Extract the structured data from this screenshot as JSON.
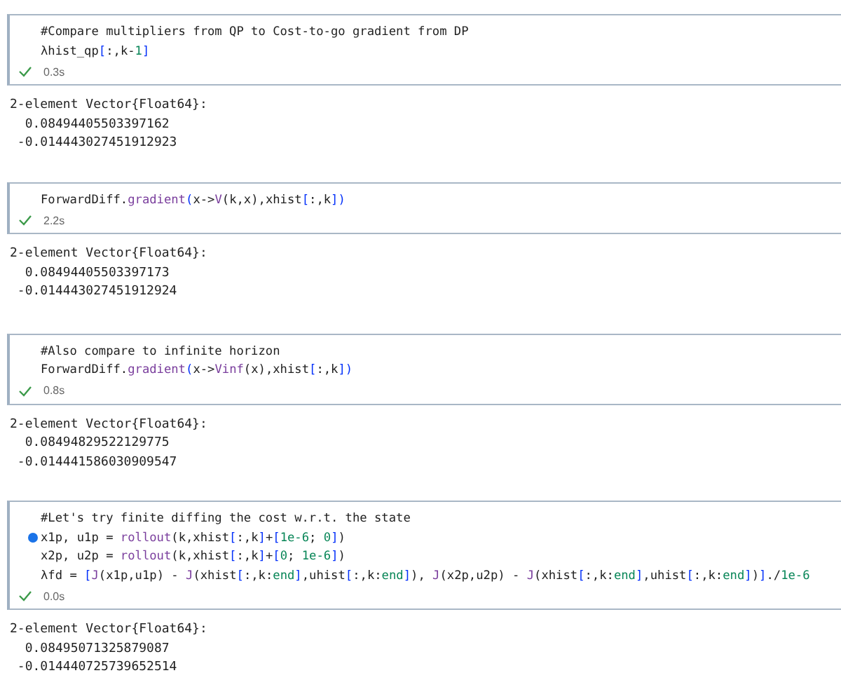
{
  "cells": [
    {
      "code_lines": [
        [
          {
            "t": "#Compare multipliers from QP to Cost-to-go gradient from DP",
            "kind": "text"
          }
        ],
        [
          {
            "t": "λhist_qp",
            "kind": "text"
          },
          {
            "t": "[",
            "kind": "bracket"
          },
          {
            "t": ":,k-",
            "kind": "text"
          },
          {
            "t": "1",
            "kind": "num"
          },
          {
            "t": "]",
            "kind": "bracket"
          }
        ]
      ],
      "time": "0.3s",
      "cursor": false,
      "output": [
        "2-element Vector{Float64}:",
        "  0.08494405503397162",
        " -0.014443027451912923"
      ]
    },
    {
      "code_lines": [
        [
          {
            "t": "ForwardDiff.",
            "kind": "text"
          },
          {
            "t": "gradient",
            "kind": "fn"
          },
          {
            "t": "(",
            "kind": "bracket"
          },
          {
            "t": "x->",
            "kind": "text"
          },
          {
            "t": "V",
            "kind": "fn"
          },
          {
            "t": "(k,x),xhist",
            "kind": "text"
          },
          {
            "t": "[",
            "kind": "bracket"
          },
          {
            "t": ":,k",
            "kind": "text"
          },
          {
            "t": "]",
            "kind": "bracket"
          },
          {
            "t": ")",
            "kind": "bracket"
          }
        ]
      ],
      "time": "2.2s",
      "cursor": false,
      "output": [
        "2-element Vector{Float64}:",
        "  0.08494405503397173",
        " -0.014443027451912924"
      ]
    },
    {
      "code_lines": [
        [
          {
            "t": "#Also compare to infinite horizon",
            "kind": "text"
          }
        ],
        [
          {
            "t": "ForwardDiff.",
            "kind": "text"
          },
          {
            "t": "gradient",
            "kind": "fn"
          },
          {
            "t": "(",
            "kind": "bracket"
          },
          {
            "t": "x->",
            "kind": "text"
          },
          {
            "t": "Vinf",
            "kind": "fn"
          },
          {
            "t": "(x),xhist",
            "kind": "text"
          },
          {
            "t": "[",
            "kind": "bracket"
          },
          {
            "t": ":,k",
            "kind": "text"
          },
          {
            "t": "]",
            "kind": "bracket"
          },
          {
            "t": ")",
            "kind": "bracket"
          }
        ]
      ],
      "time": "0.8s",
      "cursor": false,
      "output": [
        "2-element Vector{Float64}:",
        "  0.08494829522129775",
        " -0.014441586030909547"
      ]
    },
    {
      "code_lines": [
        [
          {
            "t": "#Let's try finite diffing the cost w.r.t. the state",
            "kind": "text"
          }
        ],
        [
          {
            "t": "x1p, u1p = ",
            "kind": "text"
          },
          {
            "t": "rollout",
            "kind": "fn"
          },
          {
            "t": "(k,xhist",
            "kind": "text"
          },
          {
            "t": "[",
            "kind": "bracket"
          },
          {
            "t": ":,k",
            "kind": "text"
          },
          {
            "t": "]",
            "kind": "bracket"
          },
          {
            "t": "+",
            "kind": "text"
          },
          {
            "t": "[",
            "kind": "bracket"
          },
          {
            "t": "1e-6",
            "kind": "num"
          },
          {
            "t": "; ",
            "kind": "text"
          },
          {
            "t": "0",
            "kind": "num"
          },
          {
            "t": "]",
            "kind": "bracket"
          },
          {
            "t": ")",
            "kind": "text"
          }
        ],
        [
          {
            "t": "x2p, u2p = ",
            "kind": "text"
          },
          {
            "t": "rollout",
            "kind": "fn"
          },
          {
            "t": "(k,xhist",
            "kind": "text"
          },
          {
            "t": "[",
            "kind": "bracket"
          },
          {
            "t": ":,k",
            "kind": "text"
          },
          {
            "t": "]",
            "kind": "bracket"
          },
          {
            "t": "+",
            "kind": "text"
          },
          {
            "t": "[",
            "kind": "bracket"
          },
          {
            "t": "0",
            "kind": "num"
          },
          {
            "t": "; ",
            "kind": "text"
          },
          {
            "t": "1e-6",
            "kind": "num"
          },
          {
            "t": "]",
            "kind": "bracket"
          },
          {
            "t": ")",
            "kind": "text"
          }
        ],
        [
          {
            "t": "λfd = ",
            "kind": "text"
          },
          {
            "t": "[",
            "kind": "bracket"
          },
          {
            "t": "J",
            "kind": "fn"
          },
          {
            "t": "(x1p,u1p) - ",
            "kind": "text"
          },
          {
            "t": "J",
            "kind": "fn"
          },
          {
            "t": "(xhist",
            "kind": "text"
          },
          {
            "t": "[",
            "kind": "bracket"
          },
          {
            "t": ":,k:",
            "kind": "text"
          },
          {
            "t": "end",
            "kind": "num"
          },
          {
            "t": "]",
            "kind": "bracket"
          },
          {
            "t": ",uhist",
            "kind": "text"
          },
          {
            "t": "[",
            "kind": "bracket"
          },
          {
            "t": ":,k:",
            "kind": "text"
          },
          {
            "t": "end",
            "kind": "num"
          },
          {
            "t": "]",
            "kind": "bracket"
          },
          {
            "t": "), ",
            "kind": "text"
          },
          {
            "t": "J",
            "kind": "fn"
          },
          {
            "t": "(x2p,u2p) - ",
            "kind": "text"
          },
          {
            "t": "J",
            "kind": "fn"
          },
          {
            "t": "(xhist",
            "kind": "text"
          },
          {
            "t": "[",
            "kind": "bracket"
          },
          {
            "t": ":,k:",
            "kind": "text"
          },
          {
            "t": "end",
            "kind": "num"
          },
          {
            "t": "]",
            "kind": "bracket"
          },
          {
            "t": ",uhist",
            "kind": "text"
          },
          {
            "t": "[",
            "kind": "bracket"
          },
          {
            "t": ":,k:",
            "kind": "text"
          },
          {
            "t": "end",
            "kind": "num"
          },
          {
            "t": "]",
            "kind": "bracket"
          },
          {
            "t": ")",
            "kind": "text"
          },
          {
            "t": "]",
            "kind": "bracket"
          },
          {
            "t": "./",
            "kind": "text"
          },
          {
            "t": "1e-6",
            "kind": "num"
          }
        ]
      ],
      "time": "0.0s",
      "cursor": true,
      "output": [
        "2-element Vector{Float64}:",
        "  0.08495071325879087",
        " -0.014440725739652514"
      ]
    }
  ]
}
